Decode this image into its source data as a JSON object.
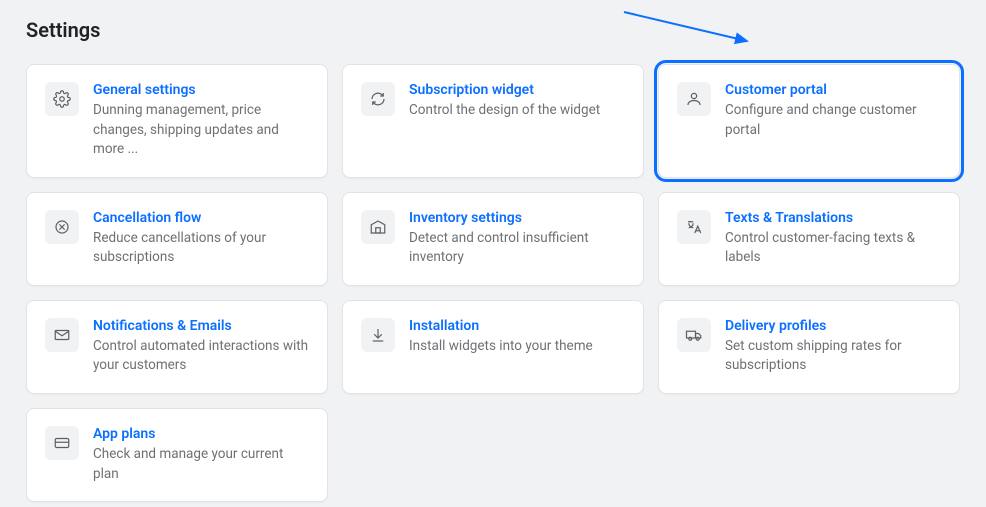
{
  "page_title": "Settings",
  "cards": [
    {
      "title": "General settings",
      "desc": "Dunning management, price changes, shipping updates and more ..."
    },
    {
      "title": "Subscription widget",
      "desc": "Control the design of the widget"
    },
    {
      "title": "Customer portal",
      "desc": "Configure and change customer portal"
    },
    {
      "title": "Cancellation flow",
      "desc": "Reduce cancellations of your subscriptions"
    },
    {
      "title": "Inventory settings",
      "desc": "Detect and control insufficient inventory"
    },
    {
      "title": "Texts & Translations",
      "desc": "Control customer-facing texts & labels"
    },
    {
      "title": "Notifications & Emails",
      "desc": "Control automated interactions with your customers"
    },
    {
      "title": "Installation",
      "desc": "Install widgets into your theme"
    },
    {
      "title": "Delivery profiles",
      "desc": "Set custom shipping rates for subscriptions"
    },
    {
      "title": "App plans",
      "desc": "Check and manage your current plan"
    }
  ],
  "highlighted_index": 2
}
